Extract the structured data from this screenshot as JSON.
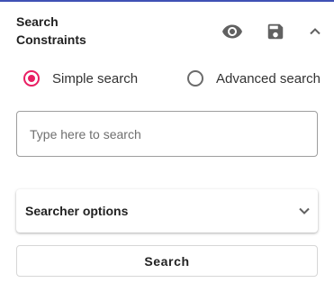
{
  "header": {
    "title_line1": "Search",
    "title_line2": "Constraints",
    "icons": [
      "eye-icon",
      "save-icon",
      "chevron-up-icon"
    ]
  },
  "search_mode": {
    "options": [
      {
        "label": "Simple search",
        "selected": true
      },
      {
        "label": "Advanced search",
        "selected": false
      }
    ]
  },
  "search": {
    "placeholder": "Type here to search",
    "value": ""
  },
  "searcher_options": {
    "label": "Searcher options",
    "expanded": false
  },
  "actions": {
    "search_label": "Search"
  },
  "colors": {
    "accent": "#e91e63",
    "top_border": "#3f51b5",
    "icon": "#616161"
  }
}
